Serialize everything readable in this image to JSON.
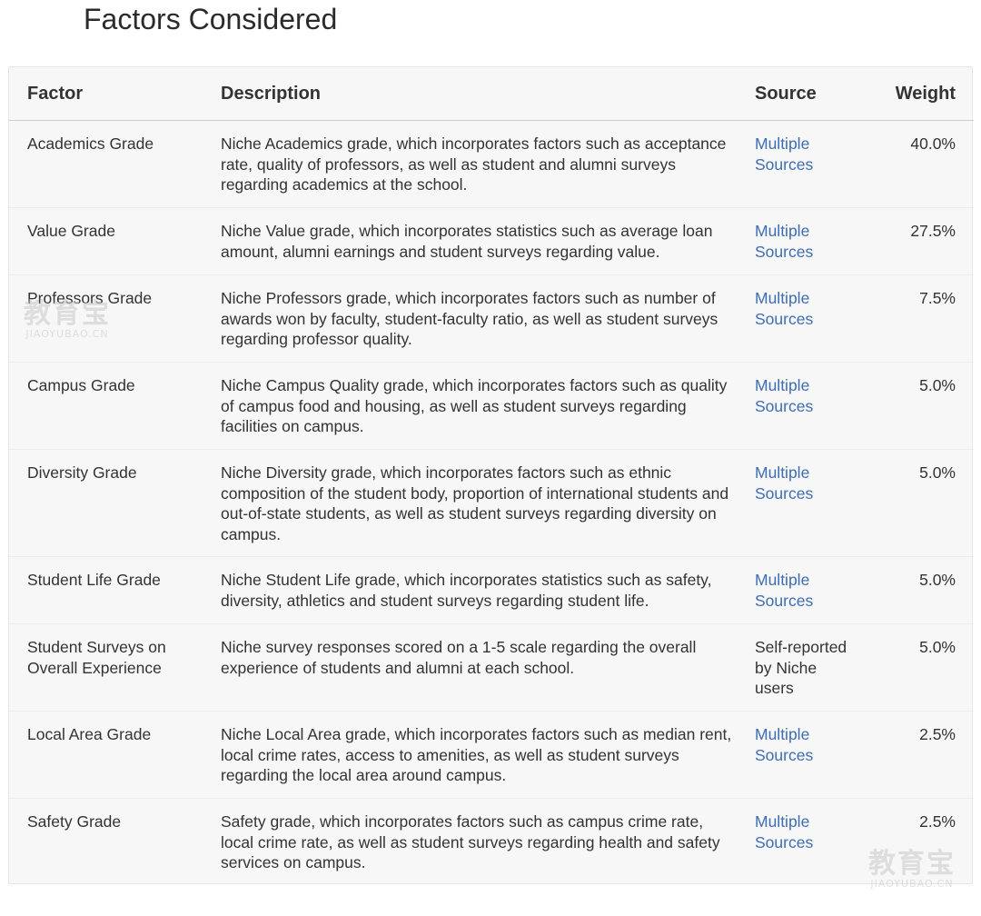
{
  "page_title": "Factors Considered",
  "table": {
    "headers": {
      "factor": "Factor",
      "description": "Description",
      "source": "Source",
      "weight": "Weight"
    },
    "rows": [
      {
        "factor": "Academics Grade",
        "description": "Niche Academics grade, which incorporates factors such as acceptance rate, quality of professors, as well as student and alumni surveys regarding academics at the school.",
        "source": "Multiple Sources",
        "weight": "40.0%"
      },
      {
        "factor": "Value Grade",
        "description": "Niche Value grade, which incorporates statistics such as average loan amount, alumni earnings and student surveys regarding value.",
        "source": "Multiple Sources",
        "weight": "27.5%"
      },
      {
        "factor": "Professors Grade",
        "description": "Niche Professors grade, which incorporates factors such as number of awards won by faculty, student-faculty ratio, as well as student surveys regarding professor quality.",
        "source": "Multiple Sources",
        "weight": "7.5%"
      },
      {
        "factor": "Campus Grade",
        "description": "Niche Campus Quality grade, which incorporates factors such as quality of campus food and housing, as well as student surveys regarding facilities on campus.",
        "source": "Multiple Sources",
        "weight": "5.0%"
      },
      {
        "factor": "Diversity Grade",
        "description": "Niche Diversity grade, which incorporates factors such as ethnic composition of the student body, proportion of international students and out-of-state students, as well as student surveys regarding diversity on campus.",
        "source": "Multiple Sources",
        "weight": "5.0%"
      },
      {
        "factor": "Student Life Grade",
        "description": "Niche Student Life grade, which incorporates statistics such as safety, diversity, athletics and student surveys regarding student life.",
        "source": "Multiple Sources",
        "weight": "5.0%"
      },
      {
        "factor": "Student Surveys on Overall Experience",
        "description": "Niche survey responses scored on a 1-5 scale regarding the overall experience of students and alumni at each school.",
        "source": "Self-reported by Niche users",
        "weight": "5.0%"
      },
      {
        "factor": "Local Area Grade",
        "description": "Niche Local Area grade, which incorporates factors such as median rent, local crime rates, access to amenities, as well as student surveys regarding the local area around campus.",
        "source": "Multiple Sources",
        "weight": "2.5%"
      },
      {
        "factor": "Safety Grade",
        "description": "Safety grade, which incorporates factors such as campus crime rate, local crime rate, as well as student surveys regarding health and safety services on campus.",
        "source": "Multiple Sources",
        "weight": "2.5%"
      }
    ]
  },
  "watermark": {
    "logo": "教育宝",
    "url": "JIAOYUBAO.CN"
  },
  "colors": {
    "link": "#3d6db3",
    "text": "#333333",
    "table_bg": "#f7f7f7"
  }
}
